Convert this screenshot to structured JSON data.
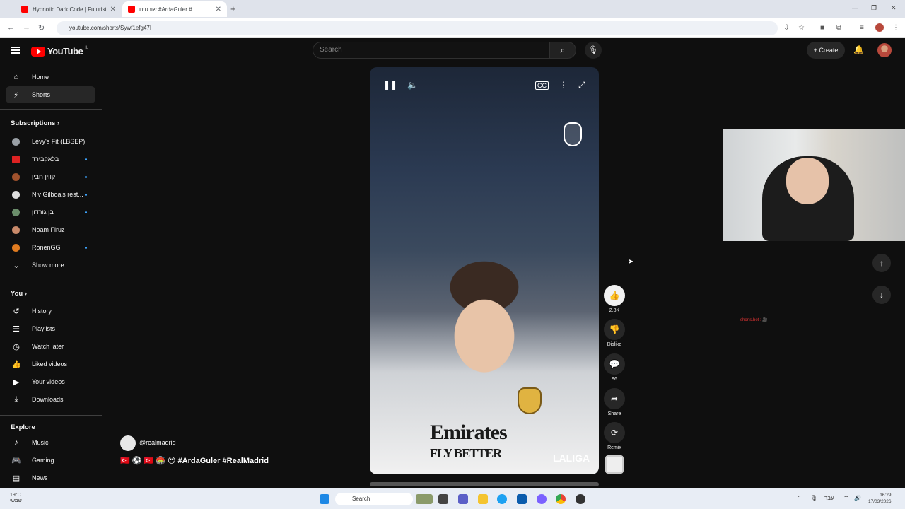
{
  "browser": {
    "tabs": [
      {
        "title": "Hypnotic Dark Code | Futuristic",
        "active": false
      },
      {
        "title": "שורטים #ArdaGuler #",
        "active": true
      }
    ],
    "url": "youtube.com/shorts/Sywf1efg47I"
  },
  "header": {
    "logo_text": "YouTube",
    "logo_country": "IL",
    "search_placeholder": "Search",
    "create_label": "Create"
  },
  "sidebar": {
    "main": [
      {
        "label": "Home",
        "icon": "home-icon"
      },
      {
        "label": "Shorts",
        "icon": "shorts-icon",
        "active": true
      }
    ],
    "subscriptions_heading": "Subscriptions",
    "subscriptions": [
      {
        "label": "Levy's Fit (LBSEP)",
        "color": "#9aa0a6",
        "dot": false
      },
      {
        "label": "בלאקבירד",
        "color": "#d22",
        "dot": true
      },
      {
        "label": "קווין חבין",
        "color": "#a0522d",
        "dot": true
      },
      {
        "label": "Niv Gilboa's rest...",
        "color": "#ddd",
        "dot": true
      },
      {
        "label": "בן גורדון",
        "color": "#6b8e6b",
        "dot": true
      },
      {
        "label": "Noam Firuz",
        "color": "#c98a6a",
        "dot": false
      },
      {
        "label": "RonenGG",
        "color": "#e07b20",
        "dot": true
      }
    ],
    "show_more": "Show more",
    "you_heading": "You",
    "you": [
      {
        "label": "History",
        "icon": "history-icon"
      },
      {
        "label": "Playlists",
        "icon": "playlists-icon"
      },
      {
        "label": "Watch later",
        "icon": "watch-later-icon"
      },
      {
        "label": "Liked videos",
        "icon": "liked-icon"
      },
      {
        "label": "Your videos",
        "icon": "your-videos-icon"
      },
      {
        "label": "Downloads",
        "icon": "downloads-icon"
      }
    ],
    "explore_heading": "Explore",
    "explore": [
      {
        "label": "Music",
        "icon": "music-icon"
      },
      {
        "label": "Gaming",
        "icon": "gaming-icon"
      },
      {
        "label": "News",
        "icon": "news-icon"
      }
    ]
  },
  "short": {
    "jersey_sponsor": "Emirates",
    "jersey_sponsor_2": "FLY BETTER",
    "league_watermark": "LALIGA",
    "channel": "@realmadrid",
    "title": "#ArdaGuler #RealMadrid",
    "title_emojis": "🇹🇷 ⚽ 🇹🇷 🏟️ 😍",
    "actions": [
      {
        "label": "2.8K",
        "icon": "like-icon"
      },
      {
        "label": "Dislike",
        "icon": "dislike-icon"
      },
      {
        "label": "96",
        "icon": "comment-icon"
      },
      {
        "label": "Share",
        "icon": "share-icon"
      },
      {
        "label": "Remix",
        "icon": "remix-icon"
      }
    ]
  },
  "overlay": {
    "red_text": "shorts.bot : 🎥"
  },
  "taskbar": {
    "weather_temp": "19°C",
    "weather_desc": "שמשי",
    "search_label": "Search",
    "lang": "עבר",
    "time": "16:29",
    "date": "17/03/2026"
  }
}
